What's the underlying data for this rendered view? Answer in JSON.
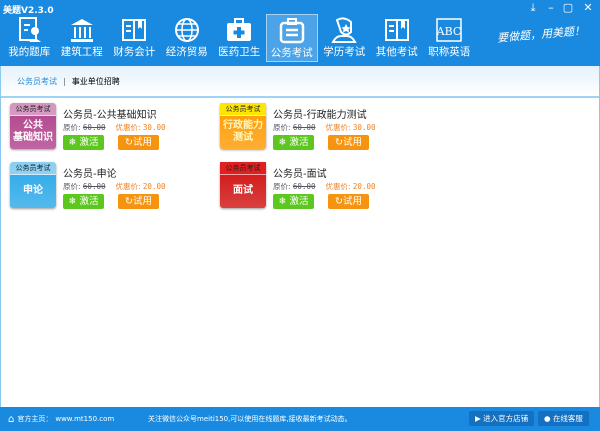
{
  "app": {
    "title": "美题V2.3.0",
    "slogan": "要做题，用美题！"
  },
  "window": {
    "download": "⤓",
    "minimize": "–",
    "maximize": "▢",
    "close": "✕"
  },
  "nav": [
    {
      "label": "我的题库",
      "icon": "user-doc"
    },
    {
      "label": "建筑工程",
      "icon": "building"
    },
    {
      "label": "财务会计",
      "icon": "book"
    },
    {
      "label": "经济贸易",
      "icon": "globe"
    },
    {
      "label": "医药卫生",
      "icon": "medical-kit"
    },
    {
      "label": "公务考试",
      "icon": "briefcase",
      "active": true
    },
    {
      "label": "学历考试",
      "icon": "person-star"
    },
    {
      "label": "其他考试",
      "icon": "book"
    },
    {
      "label": "职称英语",
      "icon": "abc"
    }
  ],
  "subnav": [
    {
      "label": "公务员考试",
      "active": true
    },
    {
      "label": "事业单位招聘"
    }
  ],
  "cards": [
    {
      "category": "公务员考试",
      "badge": "公共\n基础知识",
      "title": "公务员-公共基础知识",
      "orig_label": "原价:",
      "orig": "60.00",
      "disc_label": "优惠价:",
      "disc": "30.00",
      "activate": "激活",
      "trial": "试用",
      "color": "#b0408a"
    },
    {
      "category": "公务员考试",
      "badge": "行政能力\n测试",
      "title": "公务员-行政能力测试",
      "orig_label": "原价:",
      "orig": "60.00",
      "disc_label": "优惠价:",
      "disc": "30.00",
      "activate": "激活",
      "trial": "试用",
      "color": "#ff9a00"
    },
    {
      "category": "公务员考试",
      "badge": "申论",
      "title": "公务员-申论",
      "orig_label": "原价:",
      "orig": "60.00",
      "disc_label": "优惠价:",
      "disc": "20.00",
      "activate": "激活",
      "trial": "试用",
      "color": "#2aa8e8"
    },
    {
      "category": "公务员考试",
      "badge": "面试",
      "title": "公务员-面试",
      "orig_label": "原价:",
      "orig": "60.00",
      "disc_label": "优惠价:",
      "disc": "20.00",
      "activate": "激活",
      "trial": "试用",
      "color": "#d01010"
    }
  ],
  "footer": {
    "home_label": "官方主页：",
    "url": "www.mt150.com",
    "notice": "关注微信公众号meiti150,可以使用在线题库,接收最新考试动态。",
    "shop": "进入官方店铺",
    "service": "在线客服"
  }
}
